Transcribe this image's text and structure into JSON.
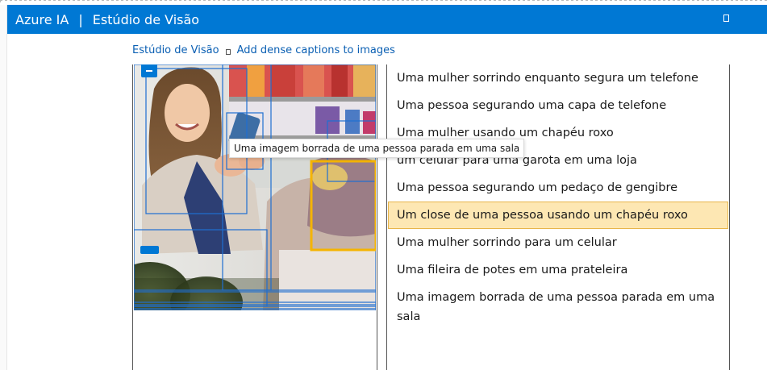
{
  "header": {
    "app_name": "Azure IA",
    "separator": "|",
    "studio_name": "Estúdio de Visão",
    "accent_color": "#0078d4"
  },
  "breadcrumb": {
    "items": [
      "Estúdio de Visão",
      "Add dense captions to images"
    ]
  },
  "tooltip": {
    "text": "Uma imagem borrada de uma pessoa parada em uma sala"
  },
  "captions": [
    {
      "text": "Uma mulher sorrindo enquanto segura um telefone",
      "highlighted": false
    },
    {
      "text": "Uma pessoa segurando uma capa de telefone",
      "highlighted": false
    },
    {
      "text": "Uma mulher usando um chapéu roxo",
      "highlighted": false
    },
    {
      "text": "um celular para uma garota em uma loja",
      "highlighted": false
    },
    {
      "text": "Uma pessoa segurando um pedaço de gengibre",
      "highlighted": false
    },
    {
      "text": "Um close de uma pessoa usando um chapéu roxo",
      "highlighted": true
    },
    {
      "text": "Uma mulher sorrindo para um celular",
      "highlighted": false
    },
    {
      "text": "Uma fileira de potes em uma prateleira",
      "highlighted": false
    },
    {
      "text": "Uma imagem borrada de uma pessoa parada em uma sala",
      "highlighted": false
    }
  ],
  "colors": {
    "box_blue": "#1f6fd1",
    "box_highlight": "#f5b400",
    "caption_highlight_bg": "#fde7b3"
  }
}
